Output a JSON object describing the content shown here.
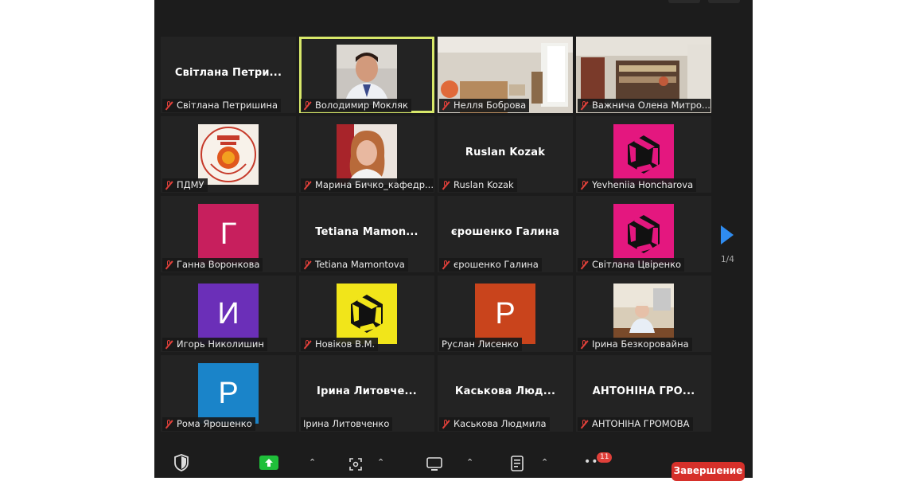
{
  "participants": [
    {
      "tile_text": "Світлана  Петри...",
      "name": "Світлана Петришина",
      "muted": true
    },
    {
      "name": "Володимир Мокляк",
      "muted": true
    },
    {
      "name": "Нелля Боброва",
      "muted": true
    },
    {
      "name": "Важнича Олена Митро...",
      "muted": true
    },
    {
      "name": "ПДМУ",
      "muted": true
    },
    {
      "name": "Марина Бичко_кафедр...",
      "muted": true
    },
    {
      "tile_text": "Ruslan Kozak",
      "name": "Ruslan Kozak",
      "muted": true
    },
    {
      "name": "Yevheniia Honcharova",
      "muted": true
    },
    {
      "avatar_letter": "Г",
      "avatar_color": "#c71f5d",
      "name": "Ганна Воронкова",
      "muted": true
    },
    {
      "tile_text": "Tetiana  Mamon...",
      "name": "Tetiana Mamontova",
      "muted": true
    },
    {
      "tile_text": "єрошенко Галина",
      "name": "єрошенко Галина",
      "muted": true
    },
    {
      "name": "Світлана Цвіренко",
      "muted": true
    },
    {
      "avatar_letter": "И",
      "avatar_color": "#6b2fb8",
      "name": "Игорь Николишин",
      "muted": true
    },
    {
      "name": "Новіков В.М.",
      "muted": true
    },
    {
      "avatar_letter": "Р",
      "avatar_color": "#c9441c",
      "name": "Руслан Лисенко",
      "muted": false
    },
    {
      "name": "Ірина Безкоровайна",
      "muted": true
    },
    {
      "avatar_letter": "Р",
      "avatar_color": "#1a84c9",
      "name": "Рома Ярошенко",
      "muted": true
    },
    {
      "tile_text": "Ірина  Литовче...",
      "name": "Ірина Литовченко",
      "muted": false
    },
    {
      "tile_text": "Каськова  Люд...",
      "name": "Каськова Людмила",
      "muted": true
    },
    {
      "tile_text": "АНТОНІНА  ГРО...",
      "name": "АНТОНІНА ГРОМОВА",
      "muted": true
    }
  ],
  "pagination": {
    "indicator": "1/4"
  },
  "toolbar": {
    "chat_badge": "11",
    "end_label": "Завершение"
  },
  "colors": {
    "active_speaker": "#d8e86a",
    "muted_icon": "#e0403a",
    "end_button": "#d6302a",
    "next_arrow": "#2f8cf0"
  }
}
